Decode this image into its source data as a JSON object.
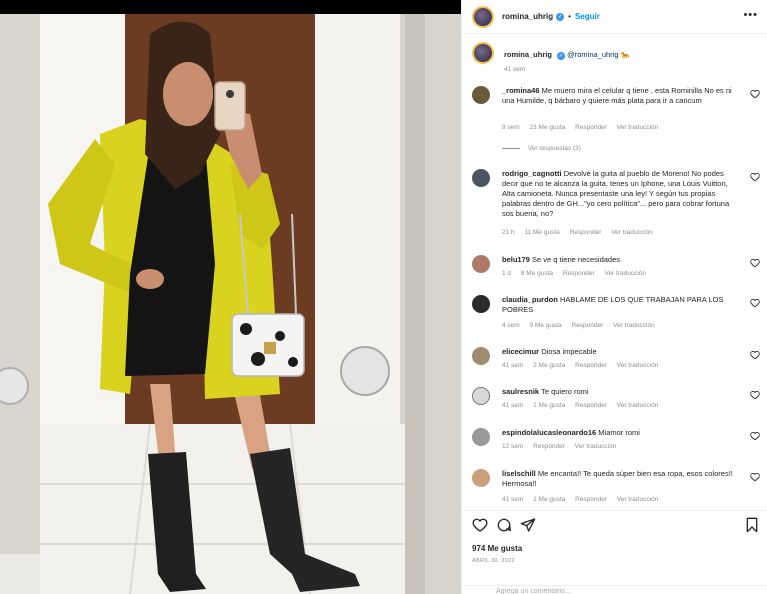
{
  "post": {
    "username": "romina_uhrig",
    "follow_label": "Seguir",
    "dot": "•",
    "more_label": "•••"
  },
  "caption": {
    "username": "romina_uhrig",
    "mention": "@romina_uhrig",
    "emoji": "🐆",
    "time": "41 sem"
  },
  "comments": [
    {
      "username": "_romina46",
      "text": "Me muero mira el celular q tiene , esta Rominilla No es ni una Humilde, q bárbaro y quiere más plata para ir a cancum",
      "time": "8 sem",
      "likes": "23 Me gusta",
      "reply": "Responder",
      "translate": "Ver traducción",
      "avatar_color": "#6b5a3a"
    },
    {
      "username": "rodrigo_cagnotti",
      "text": "Devolvé la guita al pueblo de Moreno! No podes decir que no te alcanza la guita, tenes un Iphone, una Louis Vuitton, Alta camioneta. Nunca presentaste una ley! Y según tus propias palabras dentro de GH...\"yo cero política\"... pero para cobrar fortuna sos buena, no?",
      "time": "21 h",
      "likes": "11 Me gusta",
      "reply": "Responder",
      "translate": "Ver traducción",
      "avatar_color": "#4a5560"
    },
    {
      "username": "belu179",
      "text": "Se ve q tiene necesidades",
      "time": "1 d",
      "likes": "8 Me gusta",
      "reply": "Responder",
      "translate": "Ver traducción",
      "avatar_color": "#b07a6a"
    },
    {
      "username": "claudia_purdon",
      "text": "HABLAME DE LOS QUE TRABAJAN PARA LOS POBRES",
      "time": "4 sem",
      "likes": "9 Me gusta",
      "reply": "Responder",
      "translate": "Ver traducción",
      "avatar_color": "#2b2b2b"
    },
    {
      "username": "elicecimur",
      "text": "Diosa impecable",
      "time": "41 sem",
      "likes": "2 Me gusta",
      "reply": "Responder",
      "translate": "Ver traducción",
      "avatar_color": "#a08a70"
    },
    {
      "username": "saulresnik",
      "text": "Te quiero romi",
      "time": "41 sem",
      "likes": "1 Me gusta",
      "reply": "Responder",
      "translate": "Ver traducción",
      "avatar_color": "#d8d8d8"
    },
    {
      "username": "espindolalucasleonardo16",
      "text": "Miamor romi",
      "time": "12 sem",
      "likes": "",
      "reply": "Responder",
      "translate": "Ver traducción",
      "avatar_color": "#9a9a9a"
    },
    {
      "username": "liselschill",
      "text": "Me encanta!! Te queda súper bien esa ropa, esos colores!! Hermosa!!",
      "time": "41 sem",
      "likes": "1 Me gusta",
      "reply": "Responder",
      "translate": "Ver traducción",
      "avatar_color": "#c9a07a"
    }
  ],
  "view_replies": "Ver respuestas (3)",
  "footer": {
    "likes": "974 Me gusta",
    "date": "ABRIL 30, 2022",
    "add_comment_placeholder": "Agrega un comentario..."
  },
  "colors": {
    "link": "#0095f6",
    "muted": "#8e8e8e",
    "coat": "#d9d21f"
  },
  "icons": [
    "heart-icon",
    "comment-icon",
    "share-icon",
    "bookmark-icon",
    "more-icon",
    "verified-icon"
  ]
}
